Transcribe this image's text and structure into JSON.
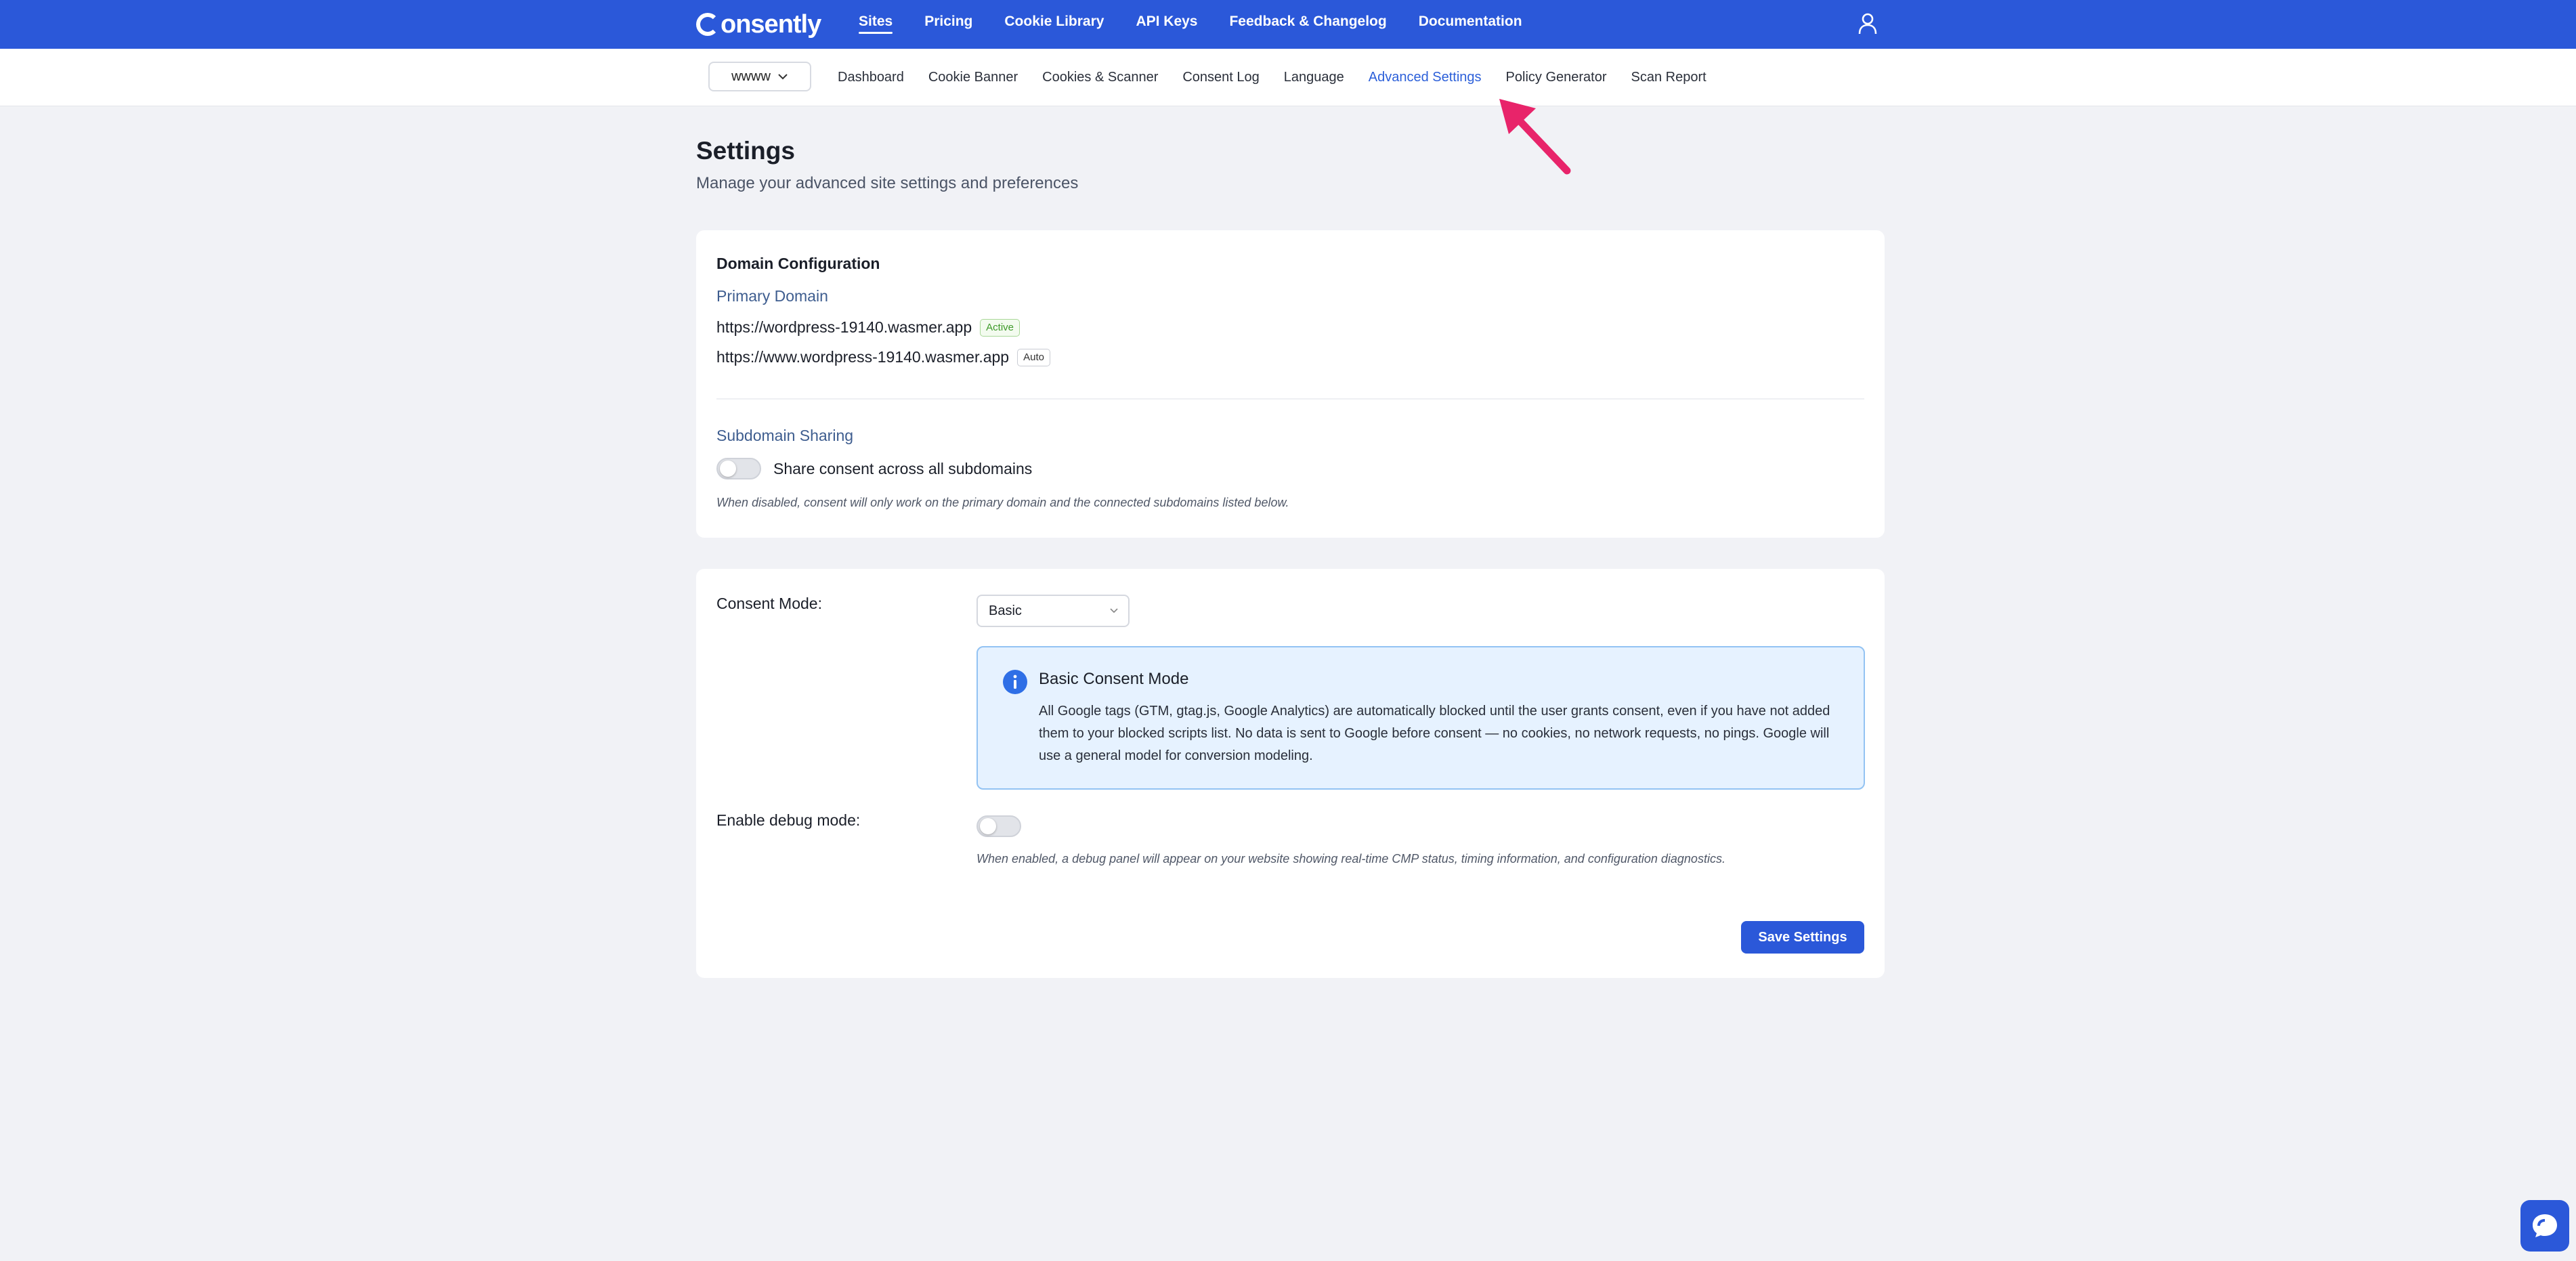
{
  "brand": {
    "name": "onsently",
    "accent": "#2b58d9"
  },
  "topnav": {
    "items": [
      {
        "label": "Sites",
        "active": true
      },
      {
        "label": "Pricing"
      },
      {
        "label": "Cookie Library"
      },
      {
        "label": "API Keys"
      },
      {
        "label": "Feedback & Changelog"
      },
      {
        "label": "Documentation"
      }
    ],
    "user_icon": "user-icon"
  },
  "subnav": {
    "site_selector": "wwww",
    "items": [
      {
        "label": "Dashboard"
      },
      {
        "label": "Cookie Banner"
      },
      {
        "label": "Cookies & Scanner"
      },
      {
        "label": "Consent Log"
      },
      {
        "label": "Language"
      },
      {
        "label": "Advanced Settings",
        "active": true
      },
      {
        "label": "Policy Generator"
      },
      {
        "label": "Scan Report"
      }
    ]
  },
  "page": {
    "title": "Settings",
    "subtitle": "Manage your advanced site settings and preferences"
  },
  "domain_config": {
    "title": "Domain Configuration",
    "primary_label": "Primary Domain",
    "domains": [
      {
        "url": "https://wordpress-19140.wasmer.app",
        "badge": "Active"
      },
      {
        "url": "https://www.wordpress-19140.wasmer.app",
        "badge": "Auto"
      }
    ],
    "subdomain_label": "Subdomain Sharing",
    "subdomain_toggle_label": "Share consent across all subdomains",
    "subdomain_toggle_on": false,
    "subdomain_hint": "When disabled, consent will only work on the primary domain and the connected subdomains listed below."
  },
  "consent": {
    "mode_label": "Consent Mode:",
    "mode_value": "Basic",
    "info_title": "Basic Consent Mode",
    "info_body": "All Google tags (GTM, gtag.js, Google Analytics) are automatically blocked until the user grants consent, even if you have not added them to your blocked scripts list. No data is sent to Google before consent — no cookies, no network requests, no pings. Google will use a general model for conversion modeling.",
    "debug_label": "Enable debug mode:",
    "debug_on": false,
    "debug_hint": "When enabled, a debug panel will appear on your website showing real-time CMP status, timing information, and configuration diagnostics.",
    "save_label": "Save Settings"
  },
  "chat_icon": "chat-bubble-icon"
}
